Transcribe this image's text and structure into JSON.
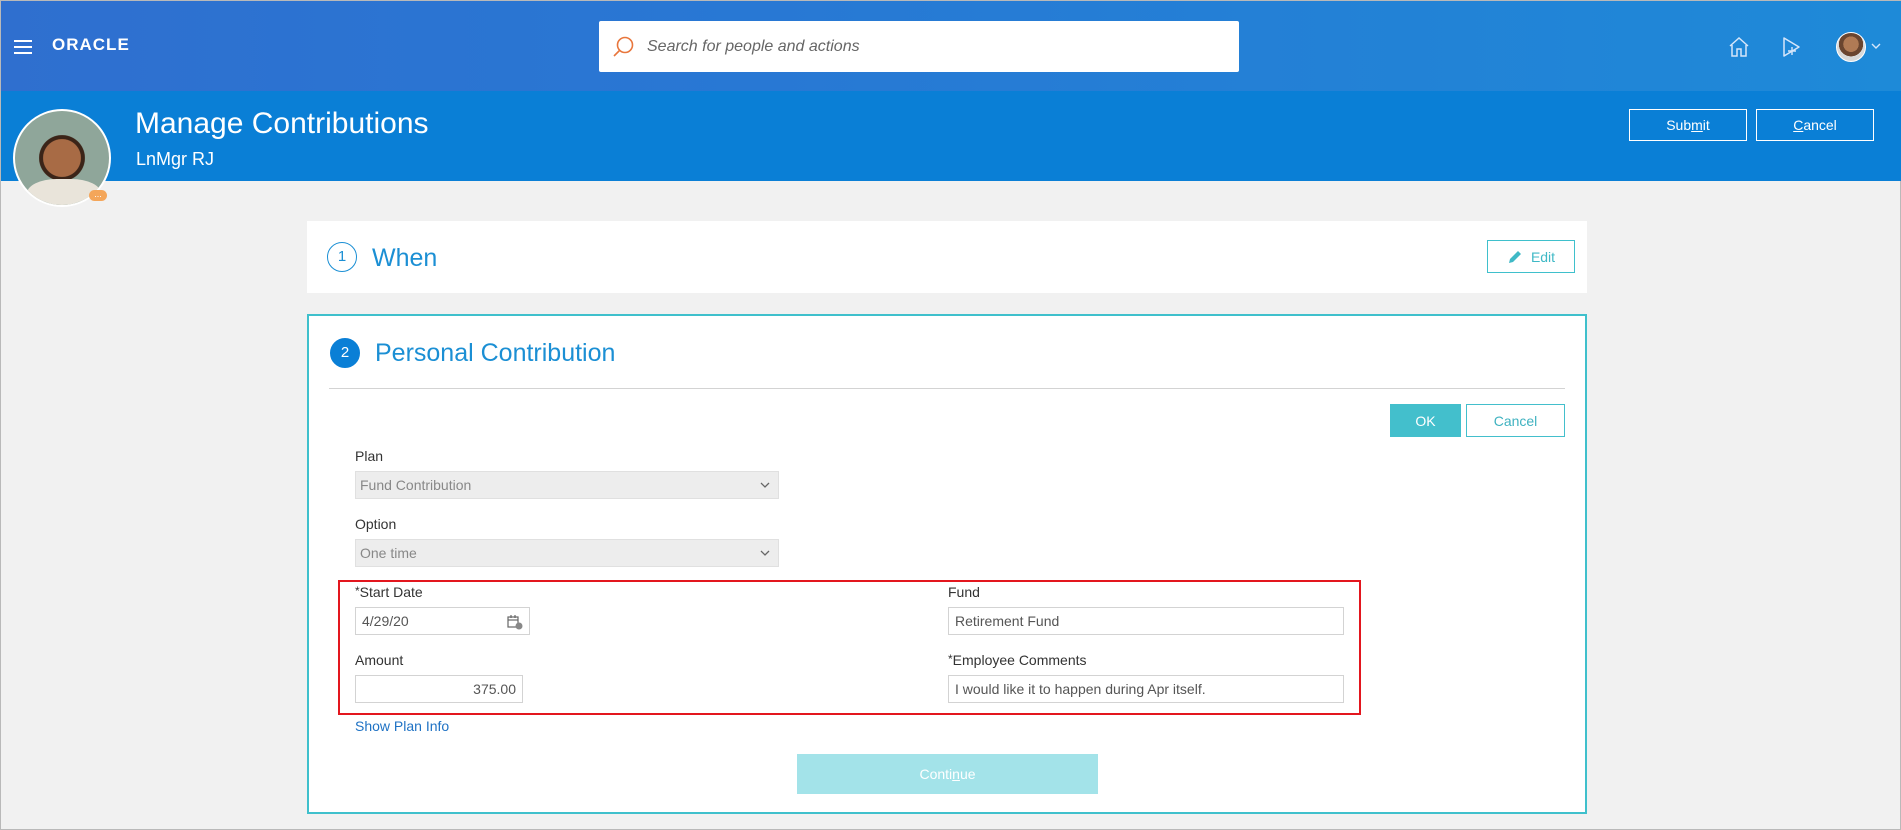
{
  "topbar": {
    "logo": "ORACLE",
    "search_placeholder": "Search for people and actions",
    "icons": [
      "menu-icon",
      "search-icon",
      "home-icon",
      "navigator-icon",
      "avatar",
      "chevron-down-icon"
    ]
  },
  "header": {
    "title": "Manage Contributions",
    "subtitle": "LnMgr RJ",
    "badge": "...",
    "submit_pre": "Sub",
    "submit_u": "m",
    "submit_post": "it",
    "cancel_pre": "",
    "cancel_u": "C",
    "cancel_post": "ancel"
  },
  "step1": {
    "number": "1",
    "title": "When",
    "edit_label": "Edit"
  },
  "step2": {
    "number": "2",
    "title": "Personal Contribution",
    "ok_label": "OK",
    "cancel_label": "Cancel",
    "plan_label": "Plan",
    "plan_value": "Fund Contribution",
    "option_label": "Option",
    "option_value": "One time",
    "start_date_label": "Start Date",
    "start_date_value": "4/29/20",
    "fund_label": "Fund",
    "fund_value": "Retirement Fund",
    "amount_label": "Amount",
    "amount_value": "375.00",
    "comments_label": "Employee Comments",
    "comments_value": "I would like it to happen during Apr itself.",
    "required_mark": "*",
    "show_plan_info": "Show Plan Info",
    "continue_pre": "Conti",
    "continue_u": "n",
    "continue_post": "ue"
  },
  "colors": {
    "topbar": "#2878d4",
    "header_band": "#0a7fd6",
    "accent_teal": "#43bfcc",
    "highlight_red": "#e3161e",
    "link": "#1f72c4"
  }
}
